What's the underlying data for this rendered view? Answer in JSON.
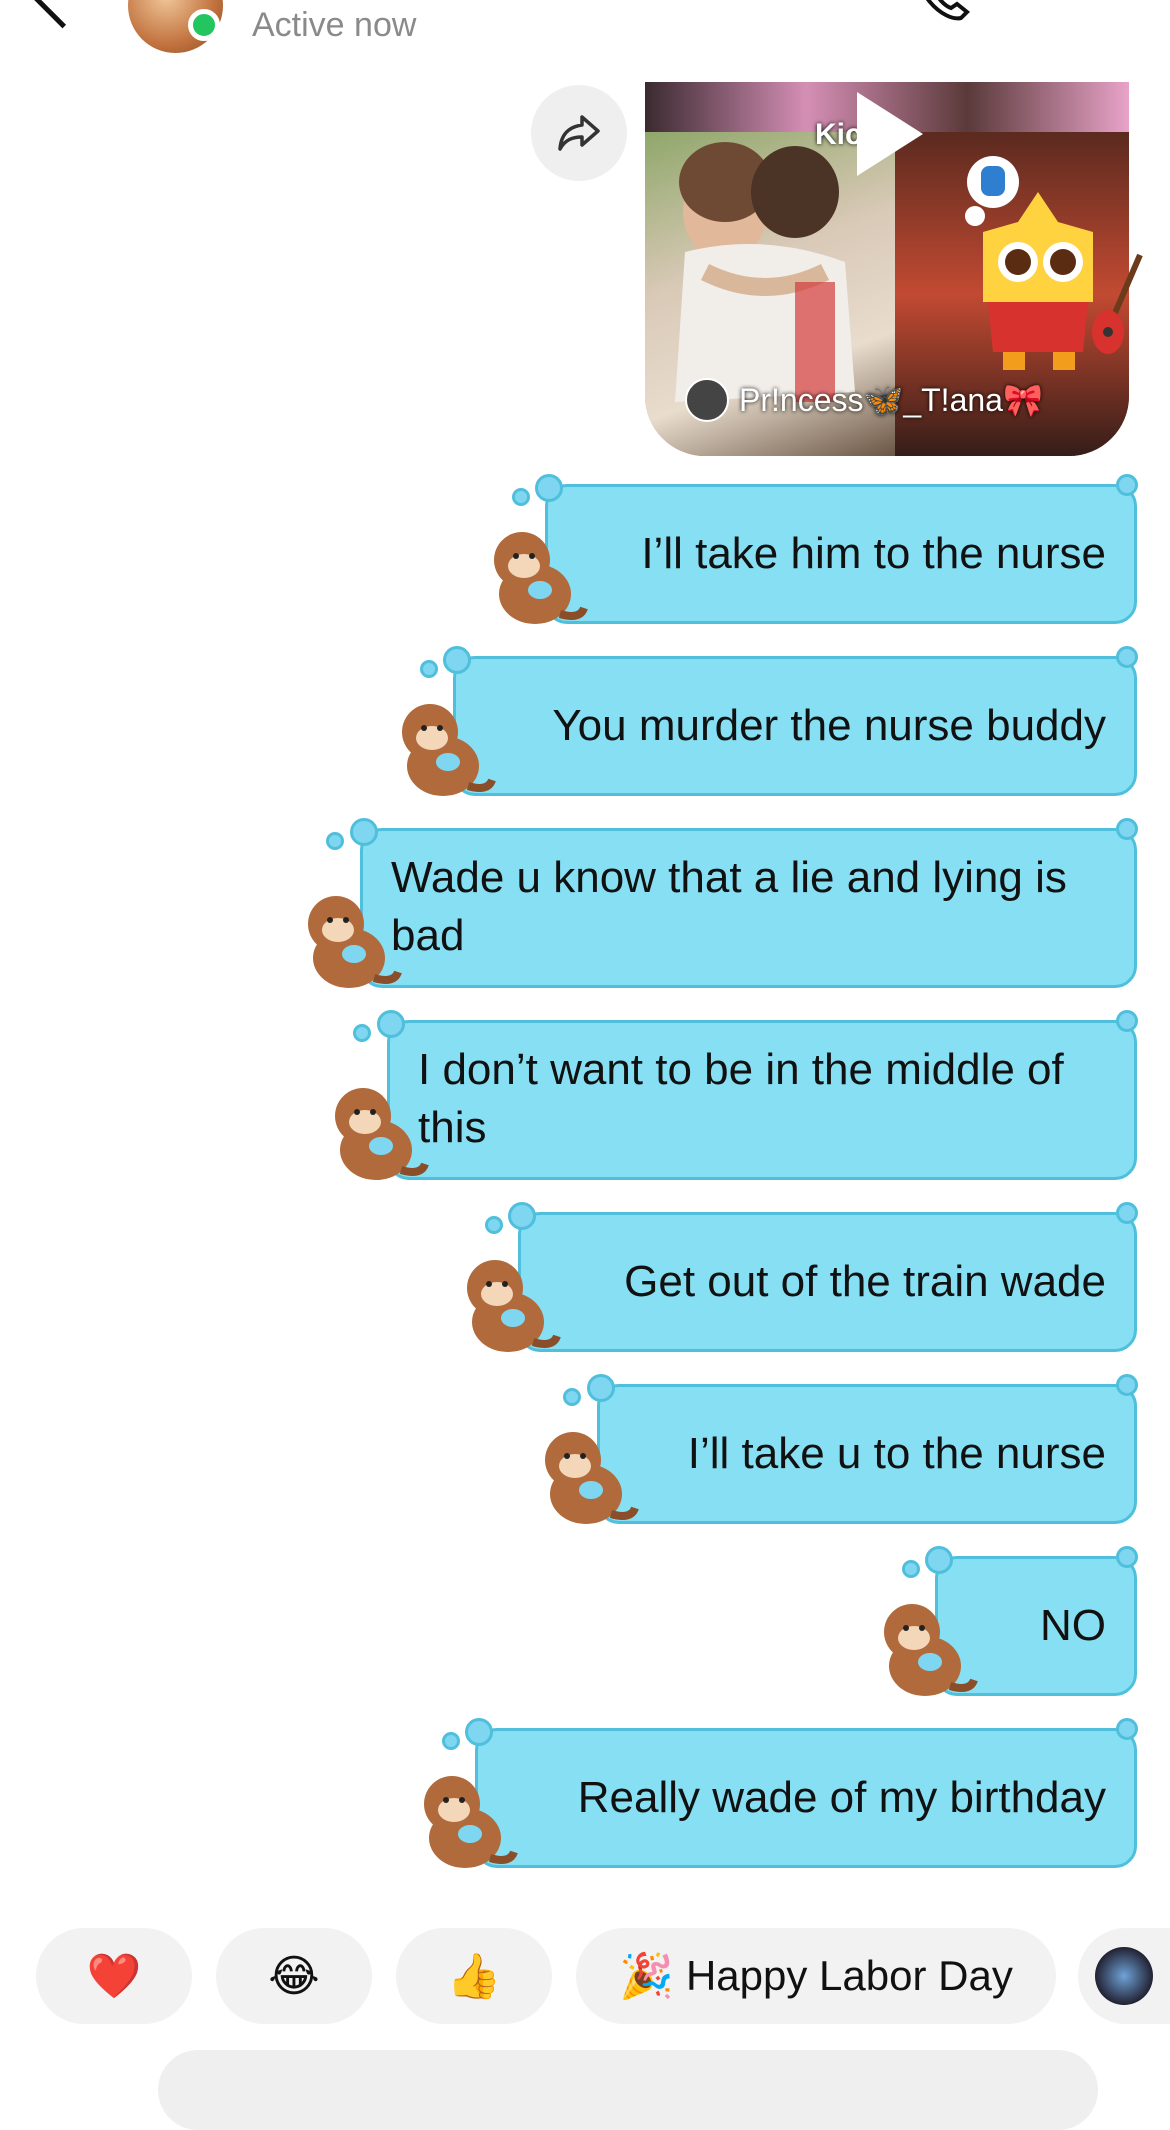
{
  "header": {
    "status": "Active now",
    "back_icon": "chevron-left-icon",
    "call_icon": "phone-icon",
    "more_icon": "more-horizontal-icon"
  },
  "video": {
    "label": "Kic",
    "creator": "Pr!ncess🦋_T!ana🎀",
    "share_icon": "share-arrow-icon"
  },
  "messages": [
    {
      "text": "I’ll take him to the nurse"
    },
    {
      "text": "You murder the nurse buddy"
    },
    {
      "text": "Wade u know that a lie and lying is bad"
    },
    {
      "text": "I don’t want to be in the middle of this"
    },
    {
      "text": "Get out of the train wade"
    },
    {
      "text": "I’ll take u to the nurse"
    },
    {
      "text": "NO"
    },
    {
      "text": "Really wade of my birthday"
    }
  ],
  "quick_reactions": [
    {
      "emoji": "❤️"
    },
    {
      "emoji": "😂"
    },
    {
      "emoji": "👍"
    },
    {
      "emoji": "🎉",
      "label": "Happy Labor Day"
    }
  ],
  "colors": {
    "bubble": "#86dff3",
    "bubble_border": "#4fbfdc",
    "online": "#22c55e"
  }
}
